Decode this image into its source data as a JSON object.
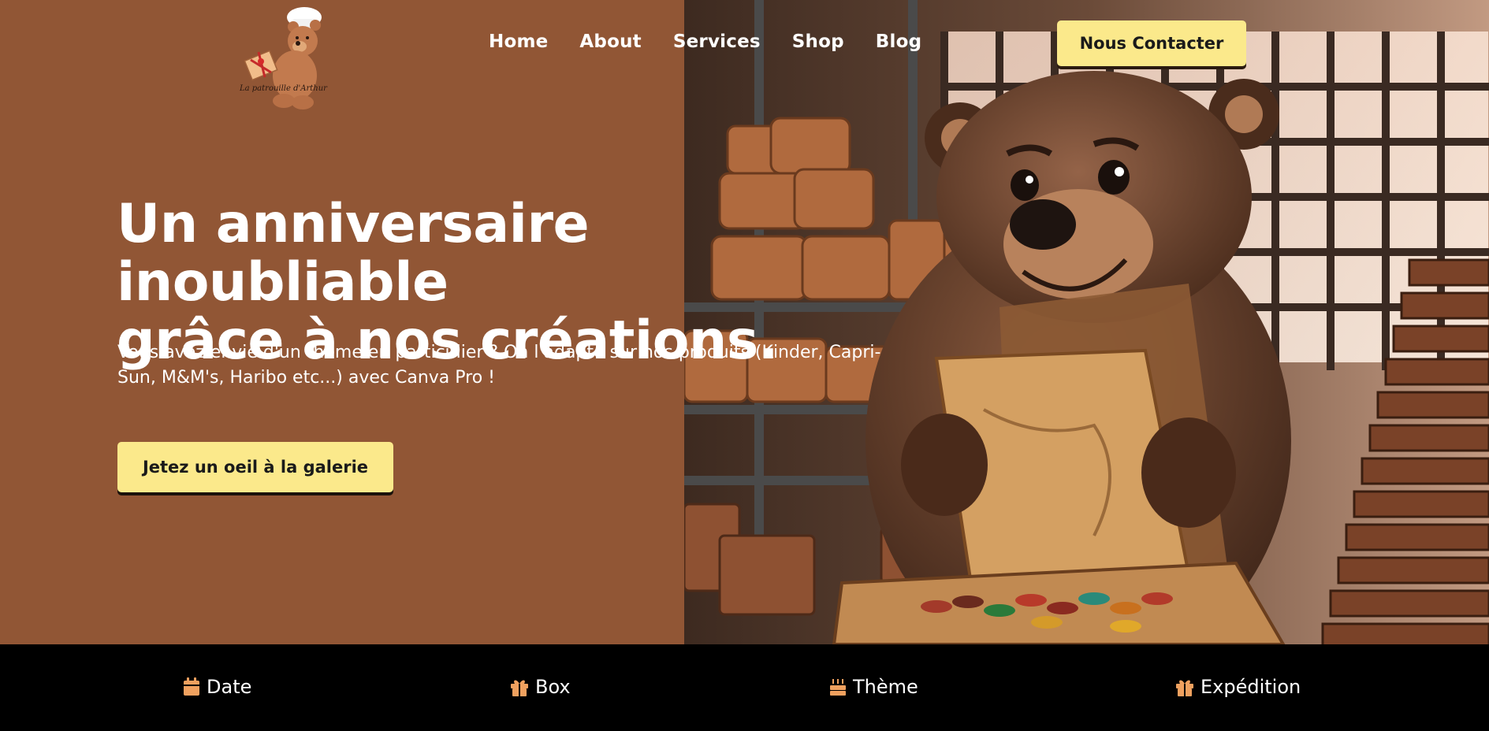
{
  "logo": {
    "text": "La patrouille d'Arthur"
  },
  "nav": {
    "items": [
      {
        "label": "Home"
      },
      {
        "label": "About"
      },
      {
        "label": "Services"
      },
      {
        "label": "Shop"
      },
      {
        "label": "Blog"
      }
    ]
  },
  "header": {
    "contact_label": "Nous Contacter"
  },
  "hero": {
    "headline_line1": "Un anniversaire inoubliable",
    "headline_line2": "grâce à nos créations.",
    "subtitle_line1": "Vous avez envie d'un thème en particulier ? On l'adapte sur nos produits (Kinder, Capri-",
    "subtitle_line2": "Sun, M&M's, Haribo etc...) avec Canva Pro !",
    "cta_label": "Jetez un oeil à la galerie"
  },
  "features": [
    {
      "label": "Date",
      "icon": "calendar-icon"
    },
    {
      "label": "Box",
      "icon": "gift-icon"
    },
    {
      "label": "Thème",
      "icon": "cake-icon"
    },
    {
      "label": "Expédition",
      "icon": "gift-icon"
    }
  ],
  "colors": {
    "hero_bg": "#915635",
    "accent_button": "#fbe98b",
    "icon_orange": "#f0a15f",
    "bar_bg": "#000000"
  }
}
